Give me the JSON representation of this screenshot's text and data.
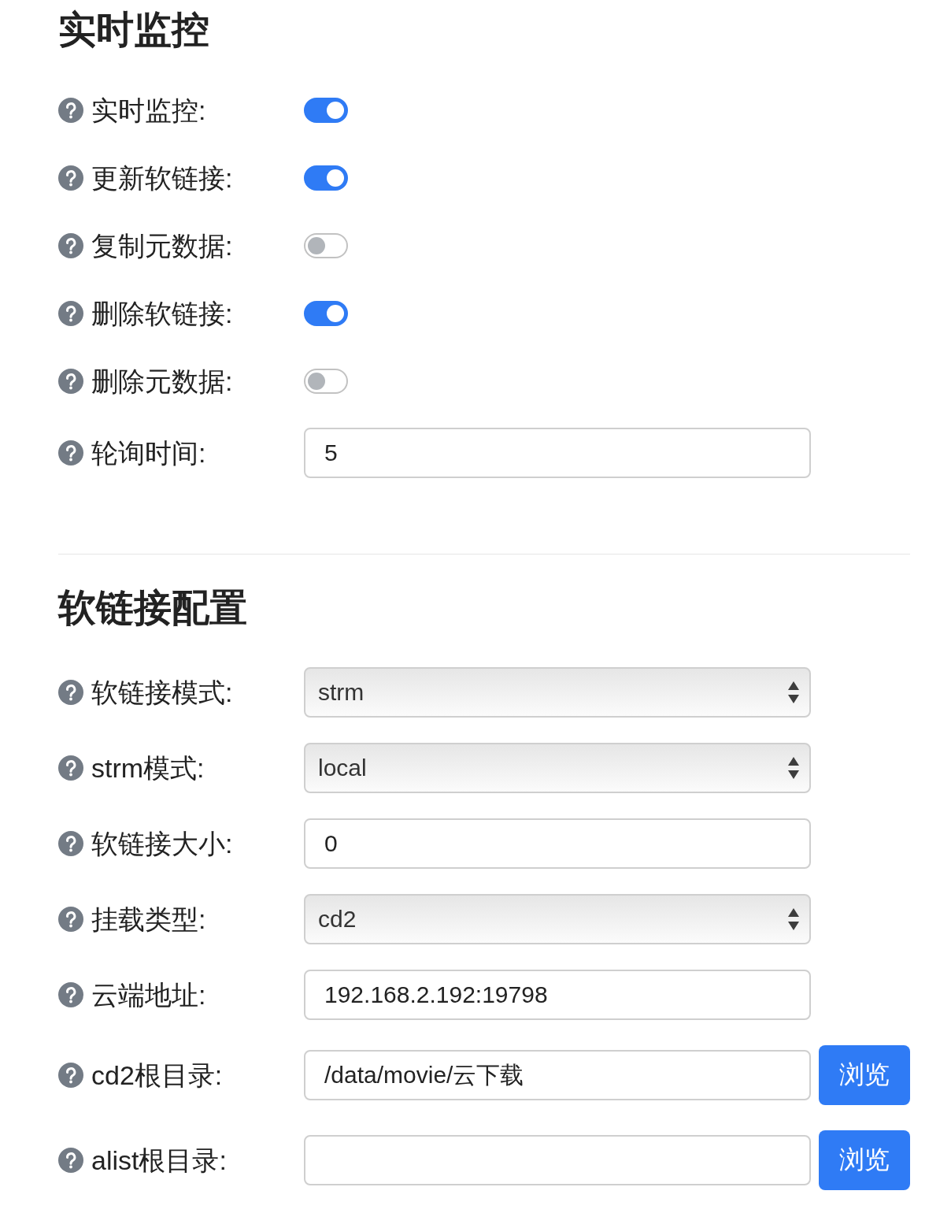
{
  "sections": [
    {
      "title": "实时监控",
      "fields": [
        {
          "label": "实时监控:",
          "kind": "toggle",
          "on": true
        },
        {
          "label": "更新软链接:",
          "kind": "toggle",
          "on": true
        },
        {
          "label": "复制元数据:",
          "kind": "toggle",
          "on": false
        },
        {
          "label": "删除软链接:",
          "kind": "toggle",
          "on": true
        },
        {
          "label": "删除元数据:",
          "kind": "toggle",
          "on": false
        },
        {
          "label": "轮询时间:",
          "kind": "text",
          "value": "5"
        }
      ]
    },
    {
      "title": "软链接配置",
      "fields": [
        {
          "label": "软链接模式:",
          "kind": "select",
          "value": "strm"
        },
        {
          "label": "strm模式:",
          "kind": "select",
          "value": "local"
        },
        {
          "label": "软链接大小:",
          "kind": "text",
          "value": "0"
        },
        {
          "label": "挂载类型:",
          "kind": "select",
          "value": "cd2"
        },
        {
          "label": "云端地址:",
          "kind": "text",
          "value": "192.168.2.192:19798"
        },
        {
          "label": "cd2根目录:",
          "kind": "text",
          "value": "/data/movie/云下载",
          "button": "浏览"
        },
        {
          "label": "alist根目录:",
          "kind": "text",
          "button": "浏览"
        }
      ]
    }
  ]
}
